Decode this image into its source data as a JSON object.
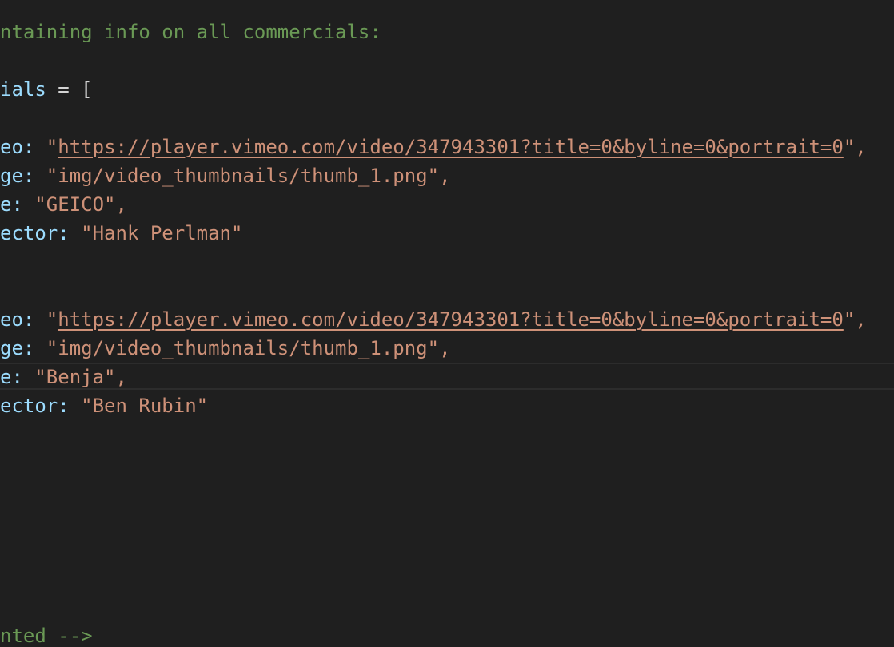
{
  "editor": {
    "comment_top": "ntaining info on all commercials:",
    "array_decl": {
      "name_fragment": "ials",
      "operator": " = ["
    },
    "entries": [
      {
        "video_key": "eo:",
        "video_open": " \"",
        "video_url": "https://player.vimeo.com/video/347943301?title=0&byline=0&portrait=0",
        "video_close": "\",",
        "image_key": "ge:",
        "image_val": " \"img/video_thumbnails/thumb_1.png\",",
        "title_key": "e:",
        "title_val": " \"GEICO\",",
        "director_key": "ector:",
        "director_val": " \"Hank Perlman\""
      },
      {
        "video_key": "eo:",
        "video_open": " \"",
        "video_url": "https://player.vimeo.com/video/347943301?title=0&byline=0&portrait=0",
        "video_close": "\",",
        "image_key": "ge:",
        "image_val": " \"img/video_thumbnails/thumb_1.png\",",
        "title_key": "e:",
        "title_val": " \"Benja\",",
        "director_key": "ector:",
        "director_val": " \"Ben Rubin\""
      }
    ],
    "comment_bottom": "nted -->"
  },
  "colors": {
    "background": "#1f1f1f",
    "comment": "#6a9955",
    "key": "#9cdcfe",
    "string": "#ce9178",
    "punctuation": "#d4d4d4"
  }
}
